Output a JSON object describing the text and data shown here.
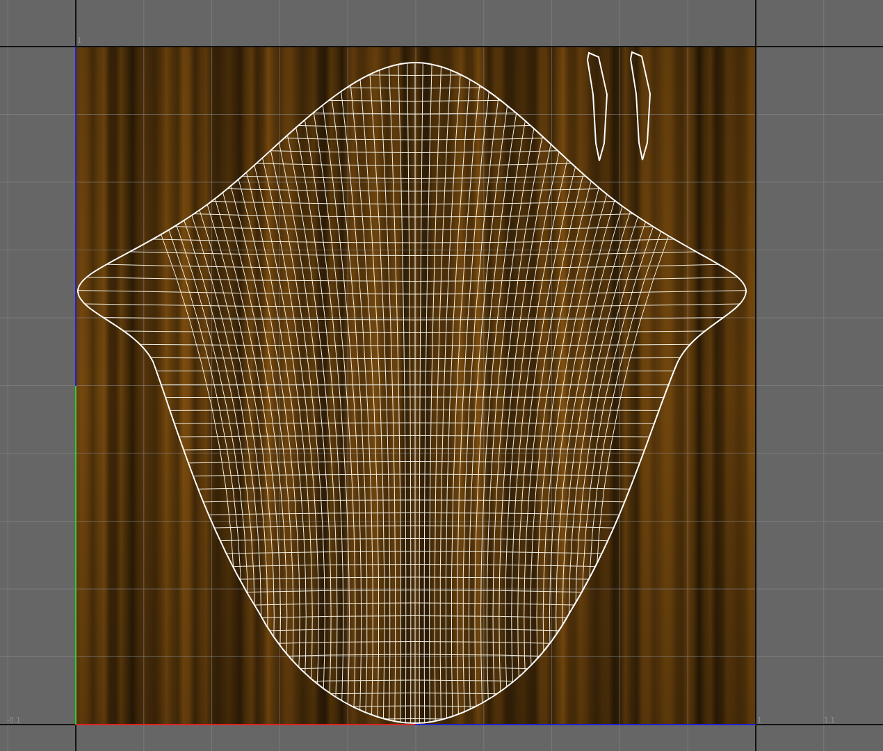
{
  "uv_editor": {
    "grid_labels": [
      "1",
      "-0.1",
      "1",
      "1.1"
    ]
  }
}
